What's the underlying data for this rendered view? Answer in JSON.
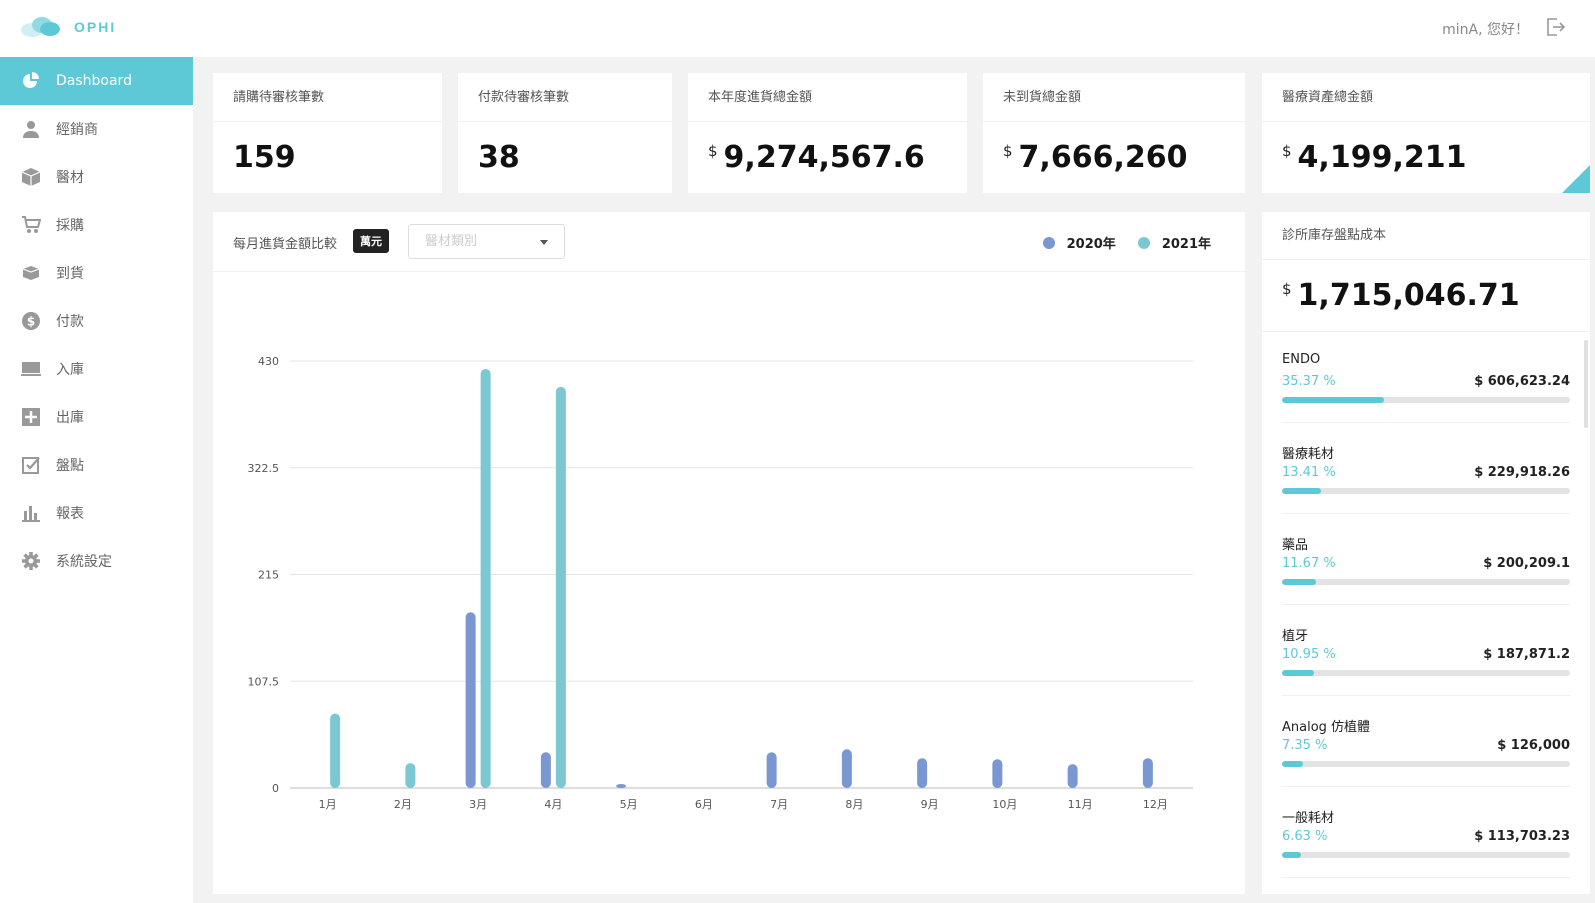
{
  "app": {
    "logo_text": "OPHI"
  },
  "header": {
    "greeting": "minA, 您好！"
  },
  "sidebar": {
    "items": [
      {
        "label": "Dashboard",
        "icon": "dashboard-icon"
      },
      {
        "label": "經銷商",
        "icon": "user-icon"
      },
      {
        "label": "醫材",
        "icon": "box-icon"
      },
      {
        "label": "採購",
        "icon": "cart-icon"
      },
      {
        "label": "到貨",
        "icon": "delivery-icon"
      },
      {
        "label": "付款",
        "icon": "dollar-icon"
      },
      {
        "label": "入庫",
        "icon": "inbound-icon"
      },
      {
        "label": "出庫",
        "icon": "outbound-icon"
      },
      {
        "label": "盤點",
        "icon": "checklist-icon"
      },
      {
        "label": "報表",
        "icon": "report-icon"
      },
      {
        "label": "系統設定",
        "icon": "gear-icon"
      }
    ]
  },
  "stats": {
    "pending_purchase": {
      "title": "請購待審核筆數",
      "value": "159"
    },
    "pending_payment": {
      "title": "付款待審核筆數",
      "value": "38"
    },
    "annual_purchase": {
      "title": "本年度進貨總金額",
      "currency": "$",
      "value": "9,274,567.6"
    },
    "undelivered": {
      "title": "未到貨總金額",
      "currency": "$",
      "value": "7,666,260"
    },
    "medical_assets": {
      "title": "醫療資產總金額",
      "currency": "$",
      "value": "4,199,211"
    }
  },
  "chart_panel": {
    "title": "每月進貨金額比較",
    "unit_badge": "萬元",
    "category_placeholder": "醫材類別"
  },
  "chart_data": {
    "type": "bar",
    "categories": [
      "1月",
      "2月",
      "3月",
      "4月",
      "5月",
      "6月",
      "7月",
      "8月",
      "9月",
      "10月",
      "11月",
      "12月"
    ],
    "series": [
      {
        "name": "2020年",
        "color": "#7b97d1",
        "values": [
          0,
          0,
          177,
          36,
          4,
          0,
          36,
          39,
          30,
          29,
          24,
          30
        ]
      },
      {
        "name": "2021年",
        "color": "#7cc8d2",
        "values": [
          75,
          25,
          422,
          404,
          0,
          0,
          0,
          0,
          0,
          0,
          0,
          0
        ]
      }
    ],
    "yticks": [
      "0",
      "107.5",
      "215",
      "322.5",
      "430"
    ],
    "ylim": [
      0,
      430
    ],
    "grid": true,
    "legend": "top-right"
  },
  "inventory": {
    "title": "診所庫存盤點成本",
    "currency": "$",
    "total": "1,715,046.71",
    "items": [
      {
        "name": "ENDO",
        "pct": "35.37 %",
        "amount": "$ 606,623.24",
        "fraction": 0.3537
      },
      {
        "name": "醫療耗材",
        "pct": "13.41 %",
        "amount": "$ 229,918.26",
        "fraction": 0.1341
      },
      {
        "name": "藥品",
        "pct": "11.67 %",
        "amount": "$ 200,209.1",
        "fraction": 0.1167
      },
      {
        "name": "植牙",
        "pct": "10.95 %",
        "amount": "$ 187,871.2",
        "fraction": 0.1095
      },
      {
        "name": "Analog 仿植體",
        "pct": "7.35 %",
        "amount": "$ 126,000",
        "fraction": 0.0735
      },
      {
        "name": "一般耗材",
        "pct": "6.63 %",
        "amount": "$ 113,703.23",
        "fraction": 0.0663
      }
    ]
  }
}
